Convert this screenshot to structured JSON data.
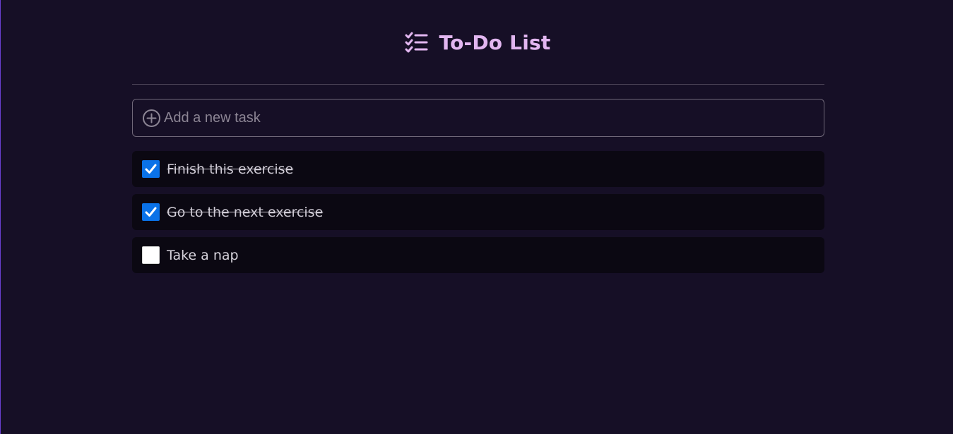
{
  "header": {
    "title": "To-Do List",
    "icon": "checklist-icon",
    "accent_color": "#e2b6f0"
  },
  "new_task": {
    "placeholder": "Add a new task",
    "value": "",
    "icon": "plus-circle-icon"
  },
  "tasks": [
    {
      "label": "Finish this exercise",
      "done": true
    },
    {
      "label": "Go to the next exercise",
      "done": true
    },
    {
      "label": "Take a nap",
      "done": false
    }
  ],
  "colors": {
    "background": "#160f26",
    "task_background": "#0b0812",
    "checkbox_checked": "#0a72e8"
  }
}
